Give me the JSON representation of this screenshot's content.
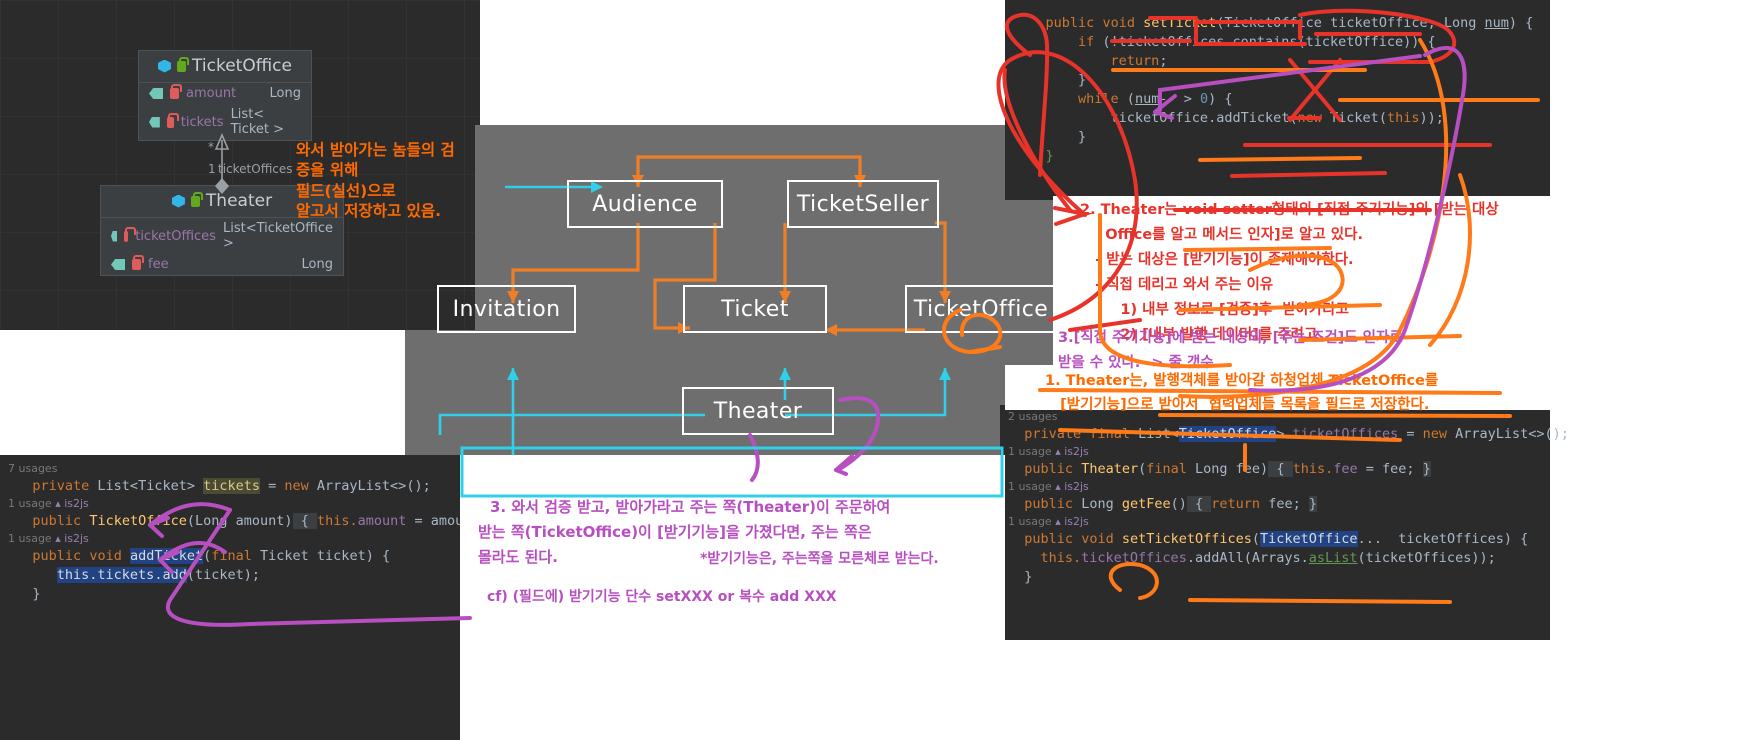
{
  "uml": {
    "classes": [
      {
        "name": "TicketOffice",
        "icons": [
          "class-icon",
          "unlock-green-icon"
        ],
        "members": [
          {
            "icons": [
              "field-icon",
              "lock-red-icon"
            ],
            "name": "amount",
            "type": "Long"
          },
          {
            "icons": [
              "field-icon",
              "lock-red-icon"
            ],
            "name": "tickets",
            "type": "List< Ticket >"
          }
        ]
      },
      {
        "name": "Theater",
        "icons": [
          "class-icon",
          "unlock-green-icon"
        ],
        "members": [
          {
            "icons": [
              "field-icon",
              "lock-red-icon"
            ],
            "name": "ticketOffices",
            "type": "List<TicketOffice >"
          },
          {
            "icons": [
              "field-icon",
              "lock-red-icon"
            ],
            "name": "fee",
            "type": "Long"
          }
        ]
      }
    ],
    "edge_labels": {
      "multiplicity_star": "*",
      "multiplicity_one": "1",
      "role": "ticketOffices"
    }
  },
  "slide": {
    "nodes": [
      {
        "id": "audience",
        "label": "Audience"
      },
      {
        "id": "ticketseller",
        "label": "TicketSeller"
      },
      {
        "id": "invitation",
        "label": "Invitation"
      },
      {
        "id": "ticket",
        "label": "Ticket"
      },
      {
        "id": "ticketoffice",
        "label": "TicketOffice"
      },
      {
        "id": "theater",
        "label": "Theater"
      }
    ]
  },
  "code_top_right": {
    "lines": [
      {
        "segs": [
          {
            "t": "    ",
            "c": "ty"
          },
          {
            "t": "public",
            "c": "kw"
          },
          {
            "t": " ",
            "c": "ty"
          },
          {
            "t": "void",
            "c": "kw"
          },
          {
            "t": " ",
            "c": "ty"
          },
          {
            "t": "setTicket",
            "c": "mth"
          },
          {
            "t": "(",
            "c": "brc"
          },
          {
            "t": "TicketOffice",
            "c": "ty"
          },
          {
            "t": " ticketOffice, ",
            "c": "ty"
          },
          {
            "t": "Long",
            "c": "ty"
          },
          {
            "t": " ",
            "c": "ty"
          },
          {
            "t": "num",
            "c": "ty_u"
          },
          {
            "t": ") {",
            "c": "brc"
          }
        ]
      },
      {
        "segs": [
          {
            "t": "        ",
            "c": "ty"
          },
          {
            "t": "if",
            "c": "kw"
          },
          {
            "t": " (!ticketOffices.",
            "c": "ty"
          },
          {
            "t": "contains",
            "c": "ty"
          },
          {
            "t": "(ticketOffice)) {",
            "c": "ty"
          }
        ]
      },
      {
        "segs": [
          {
            "t": "            ",
            "c": "ty"
          },
          {
            "t": "return",
            "c": "kw"
          },
          {
            "t": ";",
            "c": "ty"
          }
        ]
      },
      {
        "segs": [
          {
            "t": "        }",
            "c": "ty"
          }
        ]
      },
      {
        "segs": [
          {
            "t": "        ",
            "c": "ty"
          },
          {
            "t": "while",
            "c": "kw"
          },
          {
            "t": " (",
            "c": "ty"
          },
          {
            "t": "num",
            "c": "ty_u"
          },
          {
            "t": "-- > ",
            "c": "ty"
          },
          {
            "t": "0",
            "c": "num"
          },
          {
            "t": ") {",
            "c": "ty"
          }
        ]
      },
      {
        "segs": [
          {
            "t": "            ticketOffice.",
            "c": "ty"
          },
          {
            "t": "addTicket",
            "c": "ty"
          },
          {
            "t": "(",
            "c": "ty"
          },
          {
            "t": "new",
            "c": "kw"
          },
          {
            "t": " ",
            "c": "ty"
          },
          {
            "t": "Ticket",
            "c": "ty"
          },
          {
            "t": "(",
            "c": "ty"
          },
          {
            "t": "this",
            "c": "kw"
          },
          {
            "t": "));",
            "c": "ty"
          }
        ]
      },
      {
        "segs": [
          {
            "t": "        }",
            "c": "ty"
          }
        ]
      },
      {
        "segs": [
          {
            "t": "    }",
            "c": "grn"
          }
        ]
      }
    ]
  },
  "code_bottom_right": {
    "blocks": [
      {
        "usage": "2 usages",
        "author": "",
        "segs": [
          {
            "t": "  ",
            "c": "ty"
          },
          {
            "t": "private",
            "c": "kw"
          },
          {
            "t": " ",
            "c": "ty"
          },
          {
            "t": "final",
            "c": "kw"
          },
          {
            "t": " ",
            "c": "ty"
          },
          {
            "t": "List<",
            "c": "ty"
          },
          {
            "t": "TicketOffice",
            "c": "sel"
          },
          {
            "t": "> ",
            "c": "ty"
          },
          {
            "t": "ticketOffices",
            "c": "fld"
          },
          {
            "t": " = ",
            "c": "ty"
          },
          {
            "t": "new",
            "c": "kw"
          },
          {
            "t": " ArrayList<>();",
            "c": "ty"
          }
        ]
      },
      {
        "usage": "1 usage",
        "author": "is2js",
        "segs": [
          {
            "t": "  ",
            "c": "ty"
          },
          {
            "t": "public",
            "c": "kw"
          },
          {
            "t": " ",
            "c": "ty"
          },
          {
            "t": "Theater",
            "c": "mth"
          },
          {
            "t": "(",
            "c": "brc"
          },
          {
            "t": "final",
            "c": "kw"
          },
          {
            "t": " ",
            "c": "ty"
          },
          {
            "t": "Long",
            "c": "ty"
          },
          {
            "t": " fee",
            "c": "ty"
          },
          {
            "t": ")",
            "c": "brc"
          },
          {
            "t": " { ",
            "c": "hint"
          },
          {
            "t": "this.",
            "c": "kw"
          },
          {
            "t": "fee",
            "c": "fld"
          },
          {
            "t": " = fee; ",
            "c": "ty"
          },
          {
            "t": "}",
            "c": "hint"
          }
        ]
      },
      {
        "usage": "1 usage",
        "author": "is2js",
        "segs": [
          {
            "t": "  ",
            "c": "ty"
          },
          {
            "t": "public",
            "c": "kw"
          },
          {
            "t": " ",
            "c": "ty"
          },
          {
            "t": "Long",
            "c": "ty"
          },
          {
            "t": " ",
            "c": "ty"
          },
          {
            "t": "getFee",
            "c": "mth"
          },
          {
            "t": "()",
            "c": "brc"
          },
          {
            "t": " { ",
            "c": "hint"
          },
          {
            "t": "return",
            "c": "kw"
          },
          {
            "t": " fee; ",
            "c": "ty"
          },
          {
            "t": "}",
            "c": "hint"
          }
        ]
      },
      {
        "usage": "1 usage",
        "author": "is2js",
        "segs": [
          {
            "t": "  ",
            "c": "ty"
          },
          {
            "t": "public",
            "c": "kw"
          },
          {
            "t": " ",
            "c": "ty"
          },
          {
            "t": "void",
            "c": "kw"
          },
          {
            "t": " ",
            "c": "ty"
          },
          {
            "t": "setTicketOffices",
            "c": "mth"
          },
          {
            "t": "(",
            "c": "brc"
          },
          {
            "t": "TicketOffice",
            "c": "sel"
          },
          {
            "t": "...  ticketOffices",
            "c": "ty"
          },
          {
            "t": ") {",
            "c": "brc"
          }
        ]
      },
      {
        "usage": "",
        "author": "",
        "segs": [
          {
            "t": "    ",
            "c": "ty"
          },
          {
            "t": "this.",
            "c": "kw"
          },
          {
            "t": "ticketOffices",
            "c": "fld"
          },
          {
            "t": ".addAll(Arrays.",
            "c": "ty"
          },
          {
            "t": "asList",
            "c": "grn_i"
          },
          {
            "t": "(ticketOffices));",
            "c": "ty"
          }
        ]
      },
      {
        "usage": "",
        "author": "",
        "segs": [
          {
            "t": "  }",
            "c": "ty"
          }
        ]
      }
    ]
  },
  "code_bottom_left": {
    "blocks": [
      {
        "usage": "7 usages",
        "author": "",
        "segs": [
          {
            "t": "   ",
            "c": "ty"
          },
          {
            "t": "private",
            "c": "kw"
          },
          {
            "t": " List<Ticket> ",
            "c": "ty"
          },
          {
            "t": "tickets",
            "c": "selg"
          },
          {
            "t": " = ",
            "c": "ty"
          },
          {
            "t": "new",
            "c": "kw"
          },
          {
            "t": " ArrayList<>();",
            "c": "ty"
          }
        ]
      },
      {
        "usage": "1 usage",
        "author": "is2js",
        "segs": [
          {
            "t": "   ",
            "c": "ty"
          },
          {
            "t": "public",
            "c": "kw"
          },
          {
            "t": " ",
            "c": "ty"
          },
          {
            "t": "TicketOffice",
            "c": "mth"
          },
          {
            "t": "(",
            "c": "brc"
          },
          {
            "t": "Long",
            "c": "ty"
          },
          {
            "t": " amount",
            "c": "ty"
          },
          {
            "t": ")",
            "c": "brc"
          },
          {
            "t": " { ",
            "c": "hint"
          },
          {
            "t": "this.",
            "c": "kw"
          },
          {
            "t": "amount",
            "c": "fld"
          },
          {
            "t": " = amount; ",
            "c": "ty"
          },
          {
            "t": "}",
            "c": "hint"
          }
        ]
      },
      {
        "usage": "1 usage",
        "author": "is2js",
        "segs": [
          {
            "t": "   ",
            "c": "ty"
          },
          {
            "t": "public",
            "c": "kw"
          },
          {
            "t": " ",
            "c": "ty"
          },
          {
            "t": "void",
            "c": "kw"
          },
          {
            "t": " ",
            "c": "ty"
          },
          {
            "t": "addTicket",
            "c": "sel"
          },
          {
            "t": "(",
            "c": "brc"
          },
          {
            "t": "final",
            "c": "kw"
          },
          {
            "t": " Ticket ticket",
            "c": "ty"
          },
          {
            "t": ") {",
            "c": "brc"
          }
        ]
      },
      {
        "usage": "",
        "author": "",
        "segs": [
          {
            "t": "      ",
            "c": "ty"
          },
          {
            "t": "this.tickets.add",
            "c": "sel"
          },
          {
            "t": "(ticket);",
            "c": "ty"
          }
        ]
      },
      {
        "usage": "",
        "author": "",
        "segs": [
          {
            "t": "   }",
            "c": "ty"
          }
        ]
      }
    ]
  },
  "annotations": {
    "uml_note": "와서 받아가는 놈들의 검\n증을 위해\n필드(실선)으로\n알고서 저장하고 있음.",
    "note2": "2. Theater는 void setter형태의 [직접 주기기능]의 [받는 대상\n     Office를 알고 메서드 인자]로 알고 있다.\n   - 받는 대상은 [받기기능]이 존재해야한다.\n   - 직접 데리고 와서 주는 이유\n        1) 내부 정보로 [검증]후  받아가라고\n        2) [내부 발행 데이터]를 주려고",
    "note3": "3.[직접 주기기능]에 받는 대상외, [주는 조건]도 인자로\n받을 수 있다. -> 줄 갯수",
    "note1": "1. Theater는, 발행객체를 받아갈 하청업체 TicketOffice를\n   [받기기능]으로 받아서  협력업체들 목록을 필드로 저장한다.",
    "note_center_1": "3. 와서 검증 받고, 받아가라고 주는 쪽(Theater)이 주문하여",
    "note_center_2": "받는 쪽(TicketOffice)이 [받기기능]을 가졌다면, 주는 쪽은",
    "note_center_3": "몰라도 된다.",
    "note_center_4": "*받기기능은, 주는쪽을 모른체로 받는다.",
    "note_center_5": "cf) (필드에) 받기기능 단수 setXXX or 복수 add XXX"
  },
  "colors": {
    "orange": "#ff6a00",
    "red": "#e8332a",
    "purple": "#b84fc0",
    "cyan": "#2fd0e8",
    "slide_bg": "#6e6e6e",
    "ide_bg": "#2b2b2b"
  }
}
